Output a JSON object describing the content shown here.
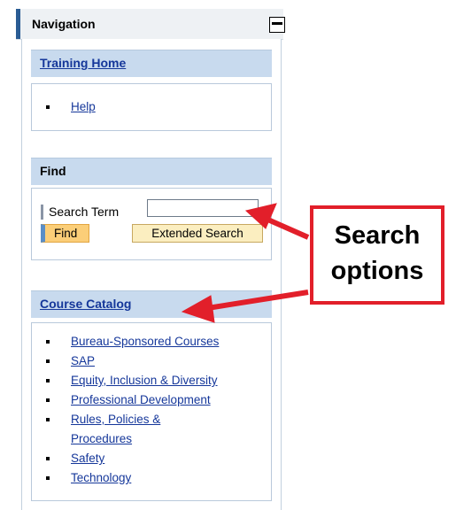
{
  "navigation": {
    "title": "Navigation",
    "collapse_icon": "minus-icon"
  },
  "training": {
    "title": "Training Home",
    "links": [
      "Help"
    ]
  },
  "find": {
    "title": "Find",
    "search_label": "Search Term",
    "search_value": "",
    "find_button": "Find",
    "extended_button": "Extended Search"
  },
  "catalog": {
    "title": "Course Catalog",
    "items": [
      "Bureau-Sponsored Courses",
      "SAP",
      "Equity, Inclusion & Diversity",
      "Professional Development",
      "Rules, Policies &",
      "Procedures",
      "Safety",
      "Technology"
    ]
  },
  "callout": {
    "line1": "Search",
    "line2": "options",
    "color": "#e21f2a"
  }
}
